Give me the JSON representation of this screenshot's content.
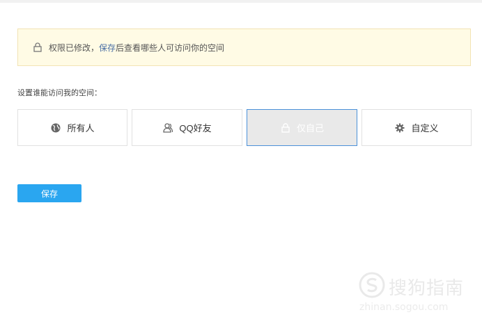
{
  "notice": {
    "text_before": "权限已修改，",
    "link_text": "保存",
    "text_after": "后查看哪些人可访问你的空间"
  },
  "access_label": "设置谁能访问我的空间：",
  "options": [
    {
      "label": "所有人",
      "icon": "globe-icon",
      "selected": false
    },
    {
      "label": "QQ好友",
      "icon": "friends-icon",
      "selected": false
    },
    {
      "label": "仅自己",
      "icon": "lock-icon",
      "selected": true
    },
    {
      "label": "自定义",
      "icon": "gear-icon",
      "selected": false
    }
  ],
  "save_button": "保存",
  "watermark": {
    "name": "搜狗指南",
    "url": "zhinan.sogou.com"
  },
  "colors": {
    "notice_bg": "#fffbe5",
    "selected_border": "#4a90d9",
    "button": "#2aa6f0"
  }
}
